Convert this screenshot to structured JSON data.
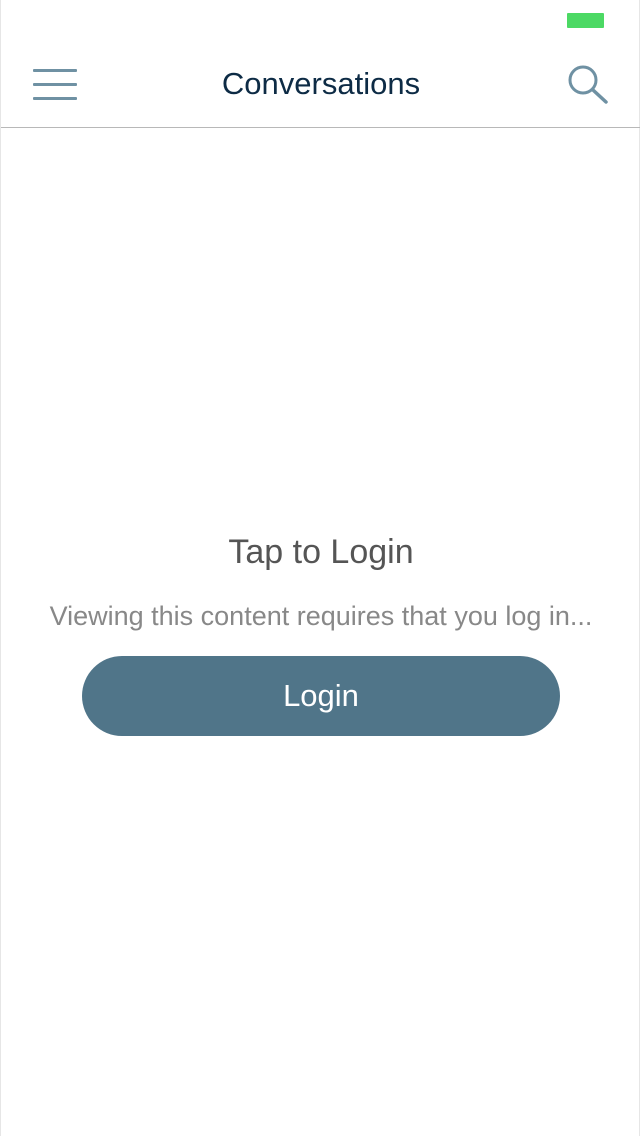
{
  "colors": {
    "battery": "#4cd964",
    "title": "#0d2b45",
    "icon": "#6f91a3",
    "button_bg": "#507589",
    "button_text": "#ffffff",
    "heading": "#555555",
    "message": "#888888"
  },
  "status_bar": {
    "battery_icon": "battery-icon"
  },
  "nav_bar": {
    "menu_icon": "hamburger-menu-icon",
    "title": "Conversations",
    "search_icon": "search-icon"
  },
  "main": {
    "heading": "Tap to Login",
    "message": "Viewing this content requires that you log in...",
    "login_button_label": "Login"
  }
}
